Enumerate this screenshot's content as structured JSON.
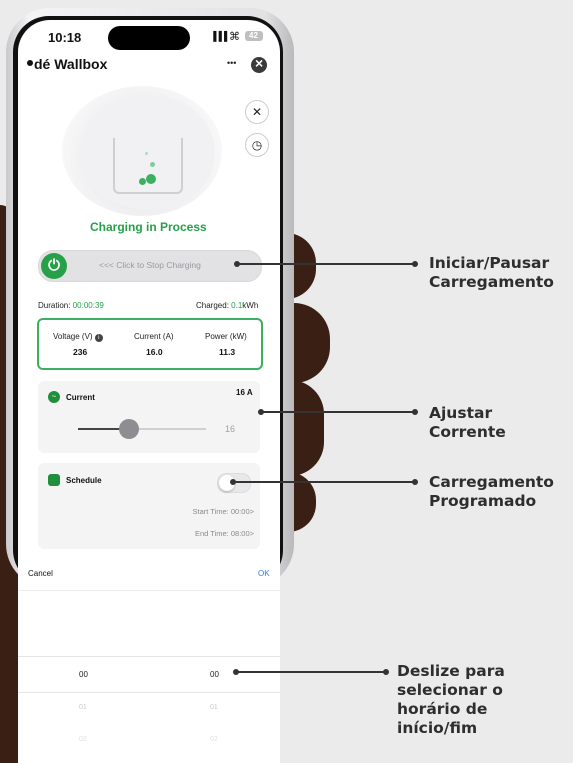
{
  "status_bar": {
    "time": "10:18",
    "signal": "▐▐▐",
    "wifi": "⌇",
    "battery": "42"
  },
  "header": {
    "title": "dé Wallbox",
    "more": "•••",
    "close": "×"
  },
  "charging": {
    "status": "Charging in Process",
    "slider_text": "<<< Click to Stop Charging",
    "duration_label": "Duration:",
    "duration_value": "00:00:39",
    "charged_label": "Charged:",
    "charged_value": "0.1",
    "charged_unit": "kWh"
  },
  "metrics": {
    "voltage": {
      "label": "Voltage (V)",
      "value": "236"
    },
    "current": {
      "label": "Current (A)",
      "value": "16.0"
    },
    "power": {
      "label": "Power (kW)",
      "value": "11.3"
    }
  },
  "current_card": {
    "title": "Current",
    "value": "16 A",
    "slider_value": "16",
    "slider_level": 0.4
  },
  "schedule_card": {
    "title": "Schedule",
    "enabled": false,
    "start": "Start Time: 00:00>",
    "end": "End Time: 08:00>"
  },
  "picker": {
    "cancel": "Cancel",
    "ok": "OK",
    "rows": [
      {
        "left": "00",
        "right": "00"
      },
      {
        "left": "01",
        "right": "01"
      },
      {
        "left": "02",
        "right": "02"
      }
    ]
  },
  "callouts": {
    "start_pause": "Iniciar/Pausar\nCarregamento",
    "adjust_current": "Ajustar\nCorrente",
    "scheduled": "Carregamento\nProgramado",
    "swipe": "Deslize para\nselecionar o\nhorário de\ninício/fim"
  },
  "colors": {
    "accent_green": "#27a04a",
    "callout_text": "#2e2e2e",
    "background": "#ebebeb"
  }
}
